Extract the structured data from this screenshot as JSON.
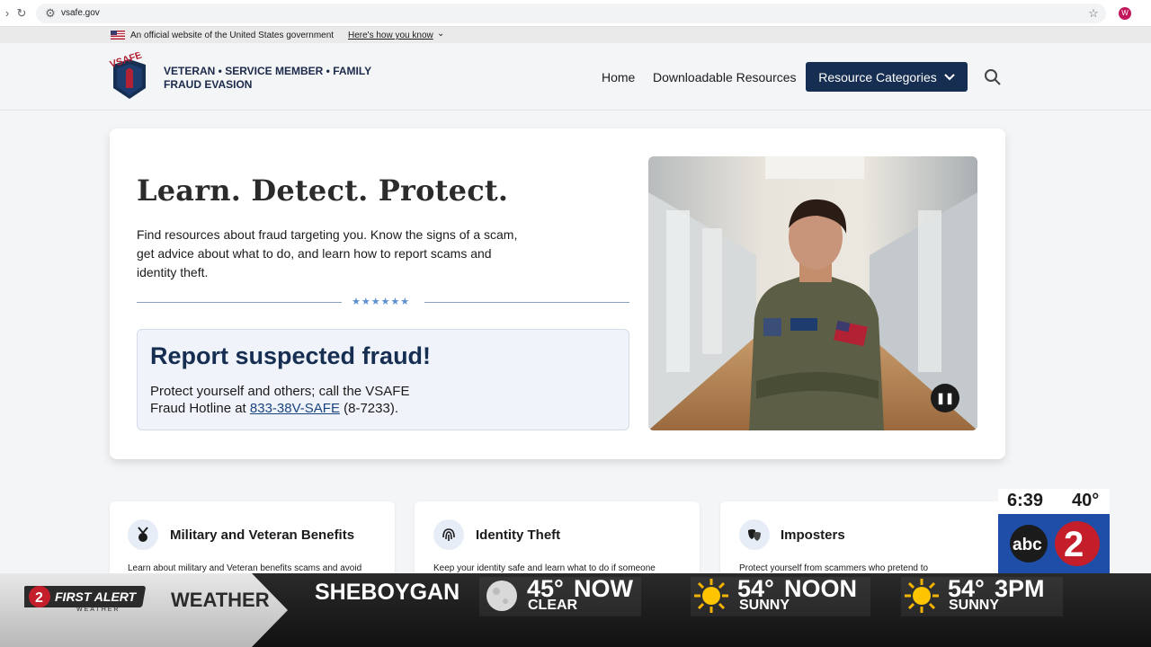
{
  "browser": {
    "url": "vsafe.gov",
    "avatar_letter": "W"
  },
  "gov_banner": {
    "text": "An official website of the United States government",
    "link": "Here's how you know"
  },
  "header": {
    "logo_text": "VSAFE",
    "title_line1": "VETERAN • SERVICE MEMBER • FAMILY",
    "title_line2": "FRAUD EVASION",
    "nav_home": "Home",
    "nav_resources": "Downloadable Resources",
    "nav_categories": "Resource Categories"
  },
  "hero": {
    "title": "Learn. Detect. Protect.",
    "description": "Find resources about fraud targeting you. Know the signs of a scam, get advice about what to do, and learn how to report scams and identity theft.",
    "stars": "★★★★★★",
    "report_title": "Report suspected fraud!",
    "report_line1": "Protect yourself and others; call the VSAFE",
    "report_line2_prefix": "Fraud Hotline at ",
    "report_phone": "833-38V-SAFE",
    "report_line2_suffix": " (8-7233)."
  },
  "cards": [
    {
      "title": "Military and Veteran Benefits",
      "desc": "Learn about military and Veteran benefits scams and avoid"
    },
    {
      "title": "Identity Theft",
      "desc": "Keep your identity safe and learn what to do if someone"
    },
    {
      "title": "Imposters",
      "desc": "Protect yourself from scammers who pretend to"
    }
  ],
  "tv": {
    "time": "6:39",
    "temp": "40°",
    "channel_logo": "abc2",
    "first_alert": "FIRST ALERT",
    "first_alert_sub": "WEATHER",
    "weather_label": "WEATHER",
    "city": "SHEBOYGAN",
    "forecast": [
      {
        "temp": "45°",
        "when": "NOW",
        "cond": "CLEAR",
        "icon": "moon-icon"
      },
      {
        "temp": "54°",
        "when": "NOON",
        "cond": "SUNNY",
        "icon": "sun-icon"
      },
      {
        "temp": "54°",
        "when": "3PM",
        "cond": "SUNNY",
        "icon": "sun-icon"
      }
    ]
  },
  "colors": {
    "navy": "#162e51",
    "link": "#1a4480",
    "accent_star": "#5b8fd1"
  }
}
